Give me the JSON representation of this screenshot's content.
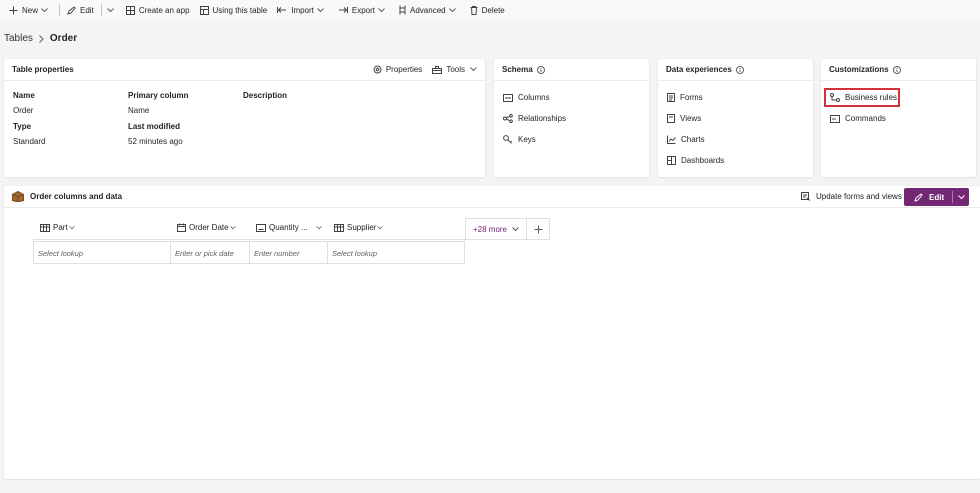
{
  "toolbar": {
    "new": "New",
    "edit": "Edit",
    "create_app": "Create an app",
    "using_table": "Using this table",
    "import": "Import",
    "export": "Export",
    "advanced": "Advanced",
    "delete": "Delete"
  },
  "breadcrumb": {
    "root": "Tables",
    "current": "Order"
  },
  "table_properties": {
    "title": "Table properties",
    "properties_btn": "Properties",
    "tools_btn": "Tools",
    "name_label": "Name",
    "name_value": "Order",
    "primary_label": "Primary column",
    "primary_value": "Name",
    "description_label": "Description",
    "type_label": "Type",
    "type_value": "Standard",
    "modified_label": "Last modified",
    "modified_value": "52 minutes ago"
  },
  "schema": {
    "title": "Schema",
    "items": [
      "Columns",
      "Relationships",
      "Keys"
    ]
  },
  "data_experiences": {
    "title": "Data experiences",
    "items": [
      "Forms",
      "Views",
      "Charts",
      "Dashboards"
    ]
  },
  "customizations": {
    "title": "Customizations",
    "items": [
      "Business rules",
      "Commands"
    ]
  },
  "columns_data": {
    "title": "Order columns and data",
    "update_btn": "Update forms and views",
    "edit_btn": "Edit",
    "columns": [
      "Part",
      "Order Date",
      "Quantity ...",
      "Supplier"
    ],
    "more": "+28 more",
    "row": [
      "Select lookup",
      "Enter or pick date",
      "Enter number",
      "Select lookup"
    ]
  },
  "colors": {
    "accent": "#742774",
    "highlight": "#d13438"
  }
}
